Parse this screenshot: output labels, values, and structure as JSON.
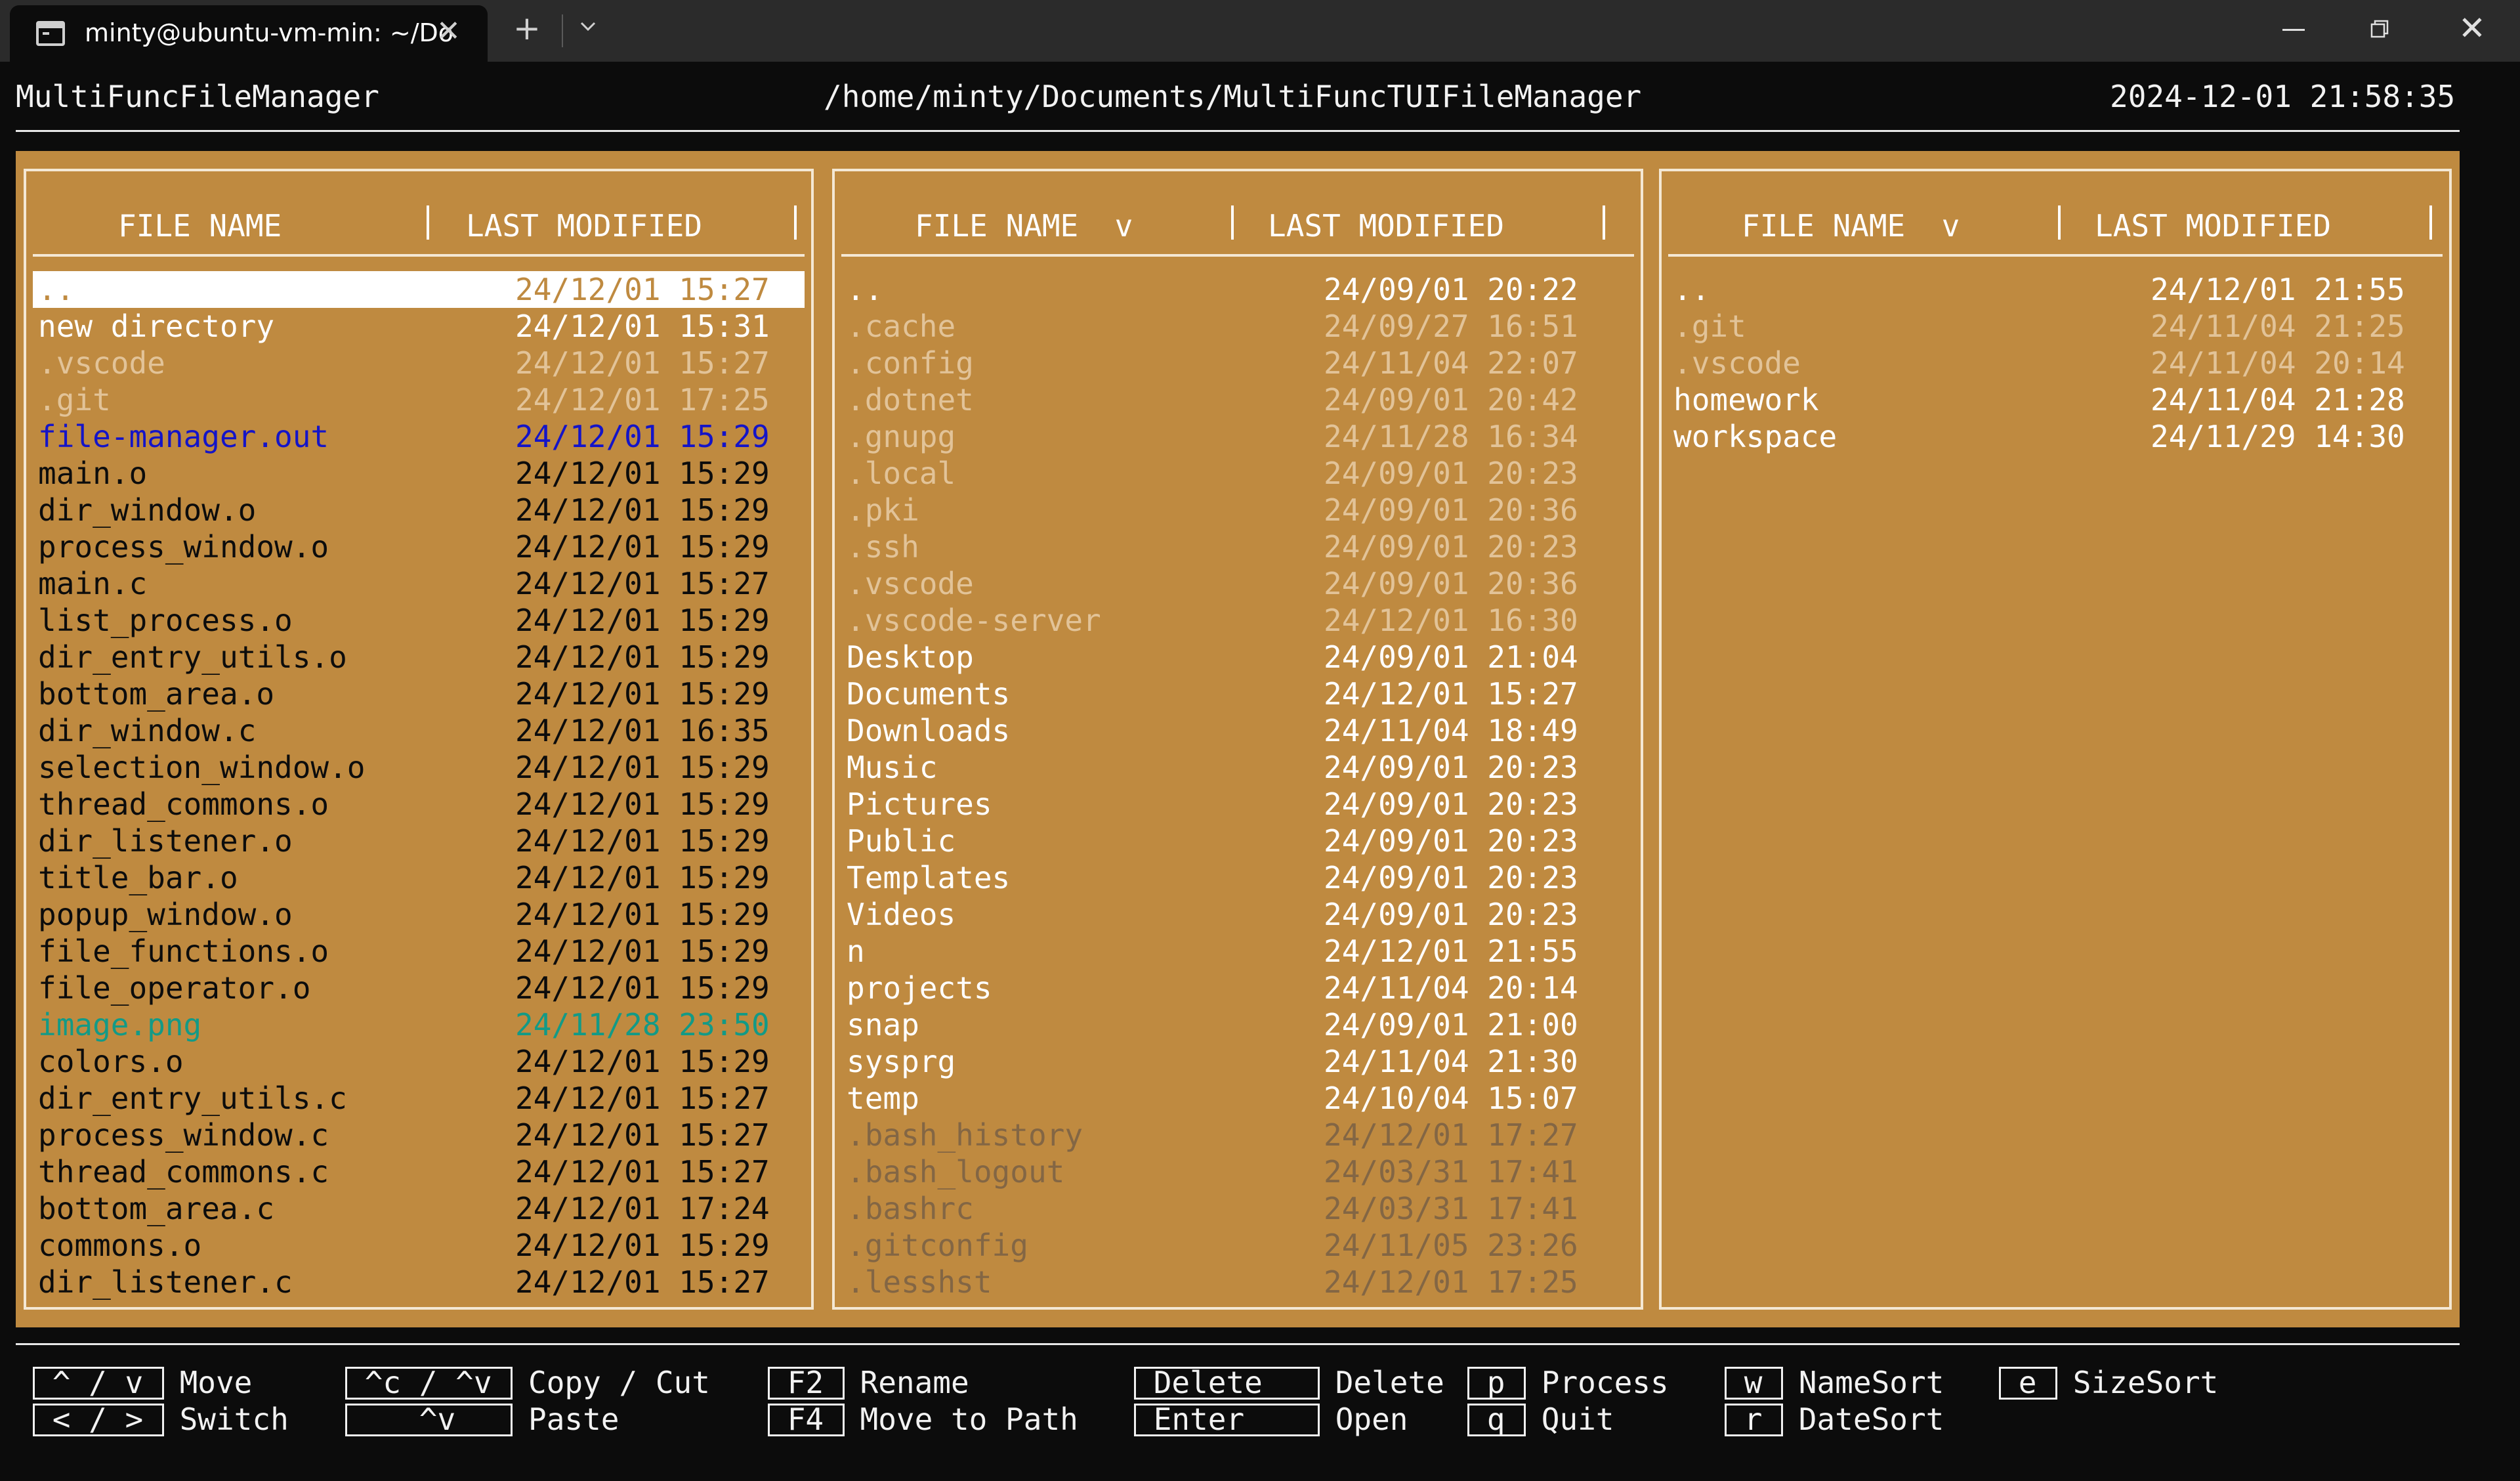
{
  "window": {
    "tab_title": "minty@ubuntu-vm-min: ~/Do",
    "close_tab_glyph": "✕",
    "new_tab_glyph": "+",
    "close_window_glyph": "✕"
  },
  "header": {
    "app_title": "MultiFuncFileManager",
    "path": "/home/minty/Documents/MultiFuncTUIFileManager",
    "datetime": "2024-12-01 21:58:35"
  },
  "panes": [
    {
      "col_name": "FILE NAME",
      "col_date": "LAST MODIFIED",
      "rows": [
        {
          "name": "..",
          "date": "24/12/01 15:27",
          "type": "selected"
        },
        {
          "name": "new directory",
          "date": "24/12/01 15:31",
          "type": "dir"
        },
        {
          "name": ".vscode",
          "date": "24/12/01 15:27",
          "type": "hidden"
        },
        {
          "name": ".git",
          "date": "24/12/01 17:25",
          "type": "hidden"
        },
        {
          "name": "file-manager.out",
          "date": "24/12/01 15:29",
          "type": "exec"
        },
        {
          "name": "main.o",
          "date": "24/12/01 15:29",
          "type": "file"
        },
        {
          "name": "dir_window.o",
          "date": "24/12/01 15:29",
          "type": "file"
        },
        {
          "name": "process_window.o",
          "date": "24/12/01 15:29",
          "type": "file"
        },
        {
          "name": "main.c",
          "date": "24/12/01 15:27",
          "type": "file"
        },
        {
          "name": "list_process.o",
          "date": "24/12/01 15:29",
          "type": "file"
        },
        {
          "name": "dir_entry_utils.o",
          "date": "24/12/01 15:29",
          "type": "file"
        },
        {
          "name": "bottom_area.o",
          "date": "24/12/01 15:29",
          "type": "file"
        },
        {
          "name": "dir_window.c",
          "date": "24/12/01 16:35",
          "type": "file"
        },
        {
          "name": "selection_window.o",
          "date": "24/12/01 15:29",
          "type": "file"
        },
        {
          "name": "thread_commons.o",
          "date": "24/12/01 15:29",
          "type": "file"
        },
        {
          "name": "dir_listener.o",
          "date": "24/12/01 15:29",
          "type": "file"
        },
        {
          "name": "title_bar.o",
          "date": "24/12/01 15:29",
          "type": "file"
        },
        {
          "name": "popup_window.o",
          "date": "24/12/01 15:29",
          "type": "file"
        },
        {
          "name": "file_functions.o",
          "date": "24/12/01 15:29",
          "type": "file"
        },
        {
          "name": "file_operator.o",
          "date": "24/12/01 15:29",
          "type": "file"
        },
        {
          "name": "image.png",
          "date": "24/11/28 23:50",
          "type": "image"
        },
        {
          "name": "colors.o",
          "date": "24/12/01 15:29",
          "type": "file"
        },
        {
          "name": "dir_entry_utils.c",
          "date": "24/12/01 15:27",
          "type": "file"
        },
        {
          "name": "process_window.c",
          "date": "24/12/01 15:27",
          "type": "file"
        },
        {
          "name": "thread_commons.c",
          "date": "24/12/01 15:27",
          "type": "file"
        },
        {
          "name": "bottom_area.c",
          "date": "24/12/01 17:24",
          "type": "file"
        },
        {
          "name": "commons.o",
          "date": "24/12/01 15:29",
          "type": "file"
        },
        {
          "name": "dir_listener.c",
          "date": "24/12/01 15:27",
          "type": "file"
        }
      ]
    },
    {
      "col_name": "FILE NAME  v",
      "col_date": "LAST MODIFIED",
      "rows": [
        {
          "name": "..",
          "date": "24/09/01 20:22",
          "type": "dir"
        },
        {
          "name": ".cache",
          "date": "24/09/27 16:51",
          "type": "hidden"
        },
        {
          "name": ".config",
          "date": "24/11/04 22:07",
          "type": "hidden"
        },
        {
          "name": ".dotnet",
          "date": "24/09/01 20:42",
          "type": "hidden"
        },
        {
          "name": ".gnupg",
          "date": "24/11/28 16:34",
          "type": "hidden"
        },
        {
          "name": ".local",
          "date": "24/09/01 20:23",
          "type": "hidden"
        },
        {
          "name": ".pki",
          "date": "24/09/01 20:36",
          "type": "hidden"
        },
        {
          "name": ".ssh",
          "date": "24/09/01 20:23",
          "type": "hidden"
        },
        {
          "name": ".vscode",
          "date": "24/09/01 20:36",
          "type": "hidden"
        },
        {
          "name": ".vscode-server",
          "date": "24/12/01 16:30",
          "type": "hidden"
        },
        {
          "name": "Desktop",
          "date": "24/09/01 21:04",
          "type": "dir"
        },
        {
          "name": "Documents",
          "date": "24/12/01 15:27",
          "type": "dir"
        },
        {
          "name": "Downloads",
          "date": "24/11/04 18:49",
          "type": "dir"
        },
        {
          "name": "Music",
          "date": "24/09/01 20:23",
          "type": "dir"
        },
        {
          "name": "Pictures",
          "date": "24/09/01 20:23",
          "type": "dir"
        },
        {
          "name": "Public",
          "date": "24/09/01 20:23",
          "type": "dir"
        },
        {
          "name": "Templates",
          "date": "24/09/01 20:23",
          "type": "dir"
        },
        {
          "name": "Videos",
          "date": "24/09/01 20:23",
          "type": "dir"
        },
        {
          "name": "n",
          "date": "24/12/01 21:55",
          "type": "dir"
        },
        {
          "name": "projects",
          "date": "24/11/04 20:14",
          "type": "dir"
        },
        {
          "name": "snap",
          "date": "24/09/01 21:00",
          "type": "dir"
        },
        {
          "name": "sysprg",
          "date": "24/11/04 21:30",
          "type": "dir"
        },
        {
          "name": "temp",
          "date": "24/10/04 15:07",
          "type": "dir"
        },
        {
          "name": ".bash_history",
          "date": "24/12/01 17:27",
          "type": "hidden-file"
        },
        {
          "name": ".bash_logout",
          "date": "24/03/31 17:41",
          "type": "hidden-file"
        },
        {
          "name": ".bashrc",
          "date": "24/03/31 17:41",
          "type": "hidden-file"
        },
        {
          "name": ".gitconfig",
          "date": "24/11/05 23:26",
          "type": "hidden-file"
        },
        {
          "name": ".lesshst",
          "date": "24/12/01 17:25",
          "type": "hidden-file"
        }
      ]
    },
    {
      "col_name": "FILE NAME  v",
      "col_date": "LAST MODIFIED",
      "rows": [
        {
          "name": "..",
          "date": "24/12/01 21:55",
          "type": "dir"
        },
        {
          "name": ".git",
          "date": "24/11/04 21:25",
          "type": "hidden"
        },
        {
          "name": ".vscode",
          "date": "24/11/04 20:14",
          "type": "hidden"
        },
        {
          "name": "homework",
          "date": "24/11/04 21:28",
          "type": "dir"
        },
        {
          "name": "workspace",
          "date": "24/11/29 14:30",
          "type": "dir"
        }
      ]
    }
  ],
  "keybindings": [
    {
      "keys": [
        "^ / v",
        "< / >"
      ],
      "labels": [
        "Move",
        "Switch"
      ]
    },
    {
      "keys": [
        "^c / ^v",
        "   ^v  "
      ],
      "labels": [
        "Copy / Cut",
        "Paste"
      ]
    },
    {
      "keys": [
        "F2",
        "F4"
      ],
      "labels": [
        "Rename",
        "Move to Path"
      ]
    },
    {
      "keys": [
        "Delete",
        "Enter "
      ],
      "labels": [
        "Delete",
        "Open"
      ]
    },
    {
      "keys": [
        "p",
        "q"
      ],
      "labels": [
        "Process",
        "Quit"
      ]
    },
    {
      "keys": [
        "w",
        "r"
      ],
      "labels": [
        "NameSort",
        "DateSort"
      ]
    },
    {
      "keys": [
        "e"
      ],
      "labels": [
        "SizeSort"
      ]
    }
  ],
  "colors": {
    "panel_bg": "#bf8a40",
    "terminal_bg": "#0c0c0c",
    "dir": "#ffffff",
    "hidden": "#e2c398",
    "file": "#0c0c0c",
    "exec": "#1414c8",
    "image": "#139a86"
  }
}
